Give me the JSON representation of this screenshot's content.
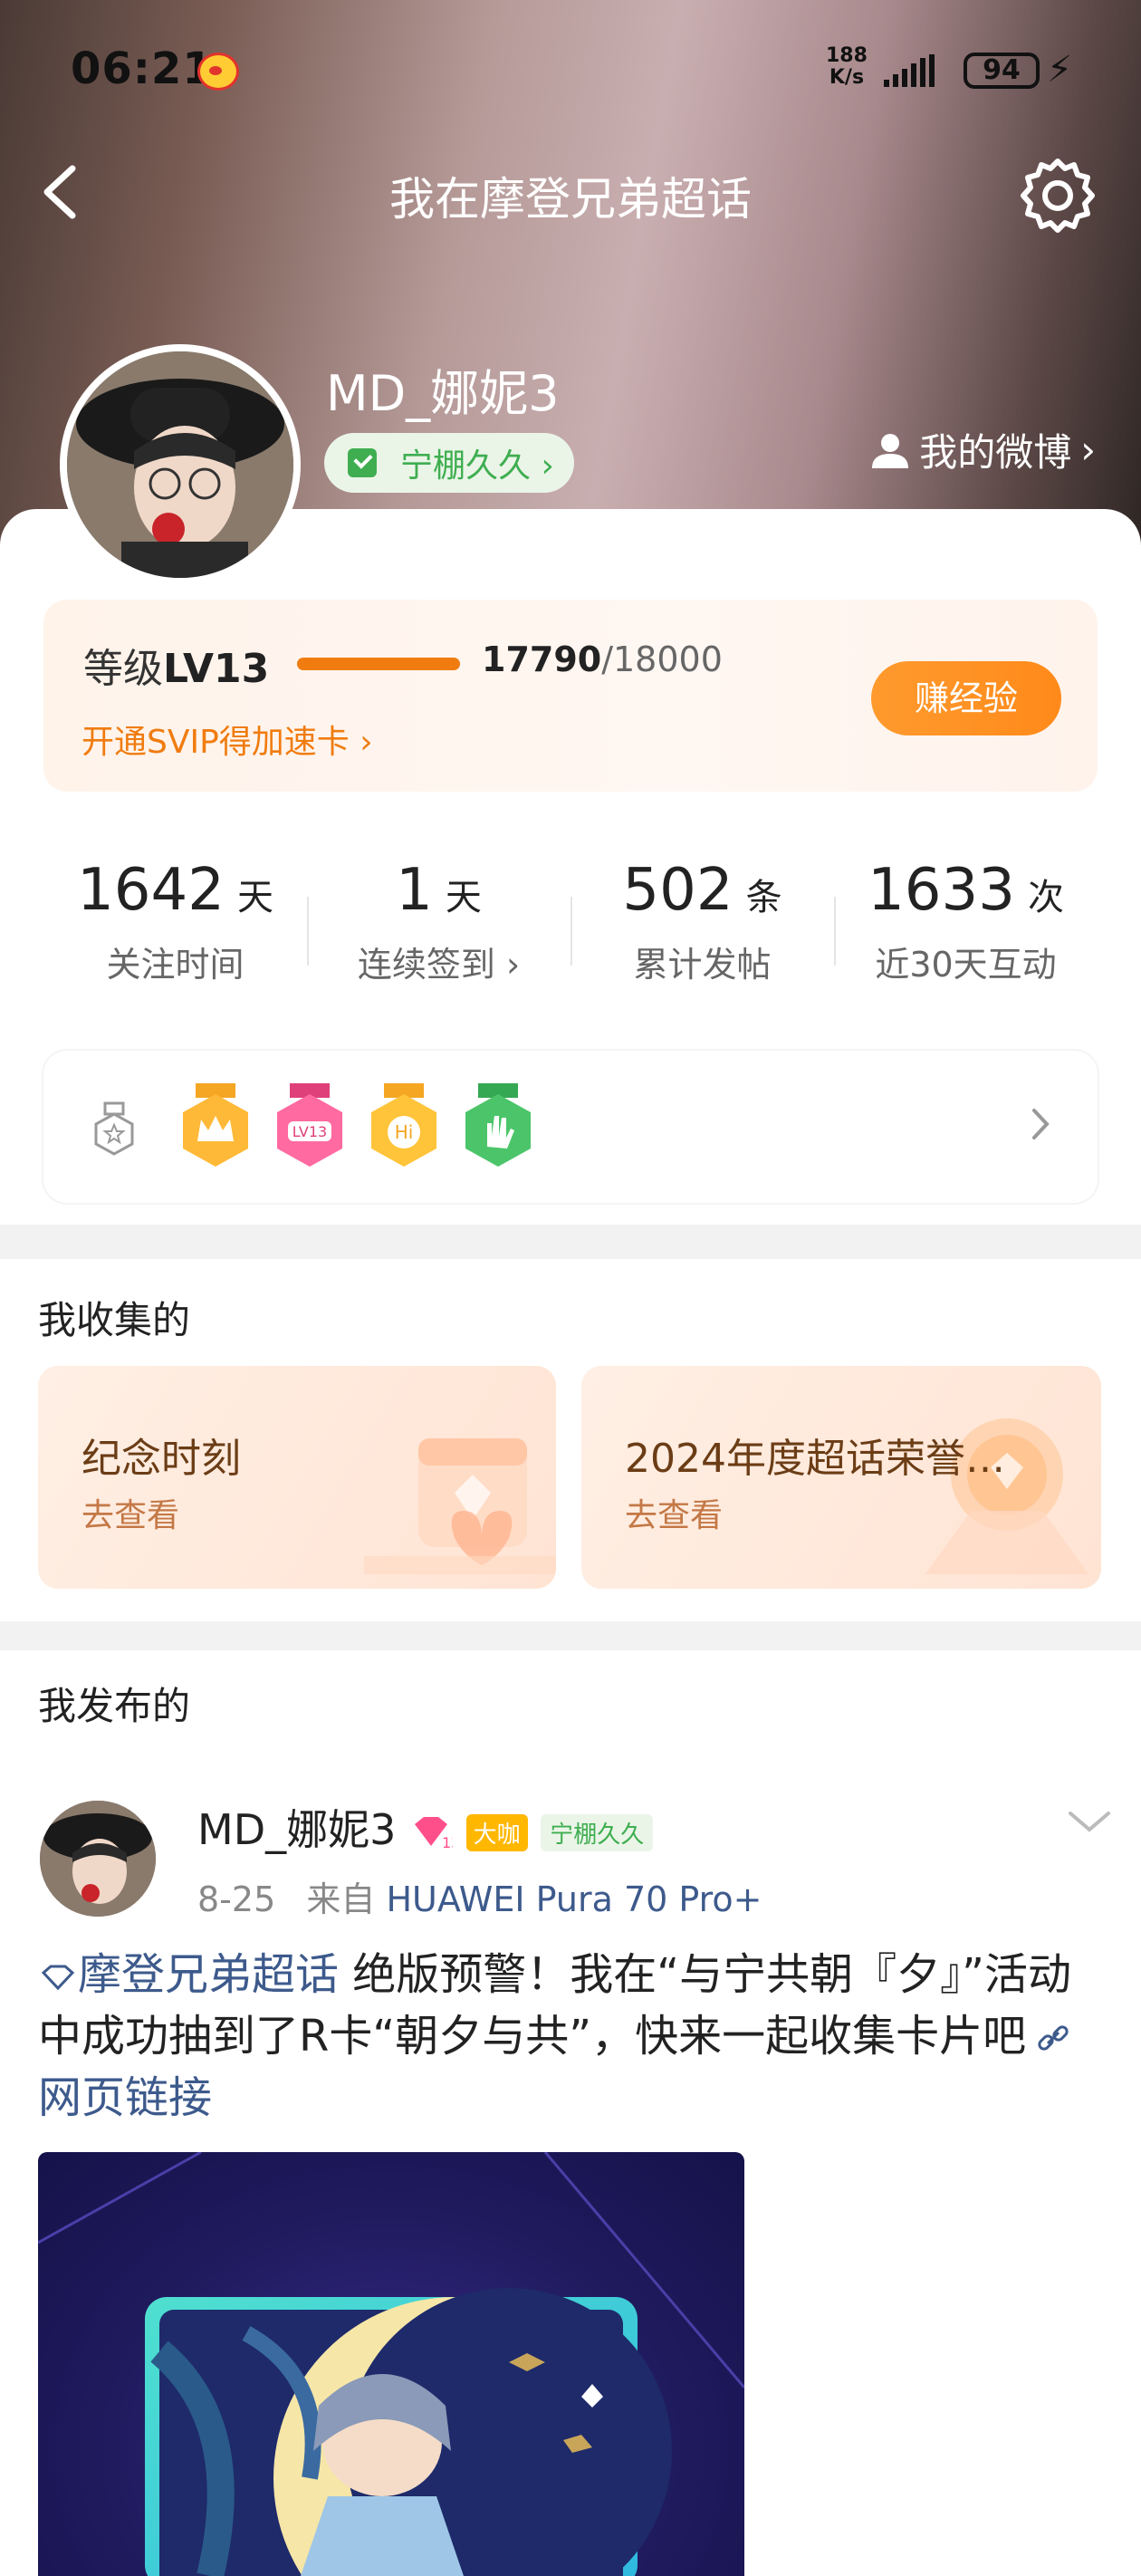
{
  "status_bar": {
    "time": "06:21",
    "net_speed_top": "188",
    "net_speed_bottom": "K/s",
    "battery": "94"
  },
  "header": {
    "title": "我在摩登兄弟超话",
    "username": "MD_娜妮3",
    "fan_badge": "宁棚久久 ›",
    "my_weibo": "我的微博"
  },
  "level": {
    "prefix": "等级",
    "level": "LV13",
    "score_current": "17790",
    "score_total": "/18000",
    "progress": 0.988,
    "svip_link": "开通SVIP得加速卡 ›",
    "earn_button": "赚经验"
  },
  "stats": [
    {
      "value": "1642",
      "unit": "天",
      "label": "关注时间"
    },
    {
      "value": "1",
      "unit": "天",
      "label": "连续签到 ›"
    },
    {
      "value": "502",
      "unit": "条",
      "label": "累计发帖"
    },
    {
      "value": "1633",
      "unit": "次",
      "label": "近30天互动"
    }
  ],
  "badges": [
    "crown-badge-icon",
    "lv13-badge-icon",
    "hi-badge-icon",
    "hand-badge-icon"
  ],
  "collected": {
    "title": "我收集的",
    "cards": [
      {
        "title": "纪念时刻",
        "sub": "去查看"
      },
      {
        "title": "2024年度超话荣誉…",
        "sub": "去查看"
      }
    ]
  },
  "published": {
    "title": "我发布的"
  },
  "post": {
    "username": "MD_娜妮3",
    "level_tag": "13",
    "daka_tag": "大咖",
    "fan_tag": "宁棚久久",
    "date": "8-25",
    "from": "来自",
    "source": "HUAWEI Pura 70 Pro+",
    "topic": "摩登兄弟超话",
    "text": "  绝版预警！我在“与宁共朝『夕』”活动中成功抽到了R卡“朝夕与共”，快来一起收集卡片吧",
    "link": "网页链接",
    "card_rarity": "R"
  },
  "colors": {
    "accent_orange": "#f07c10",
    "link_blue": "#3d5a8c",
    "fan_green": "#3fae50"
  }
}
